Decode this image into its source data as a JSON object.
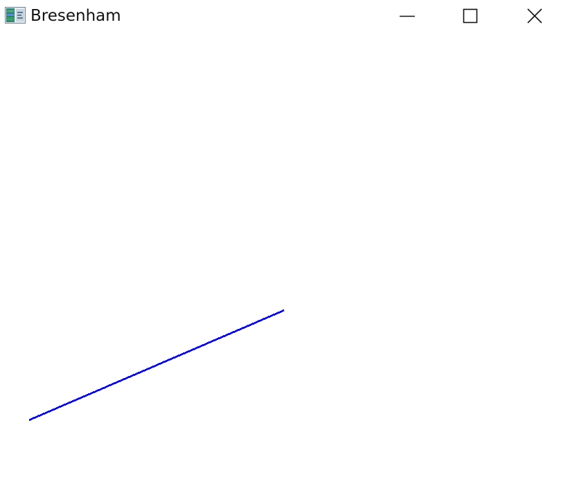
{
  "window": {
    "title": "Bresenham",
    "icon": "java-app-icon",
    "buttons": {
      "minimize_icon": "minimize-icon",
      "maximize_icon": "maximize-icon",
      "close_icon": "close-icon"
    }
  },
  "drawing": {
    "line_color": "#1010c0",
    "background_color": "#ffffff"
  }
}
